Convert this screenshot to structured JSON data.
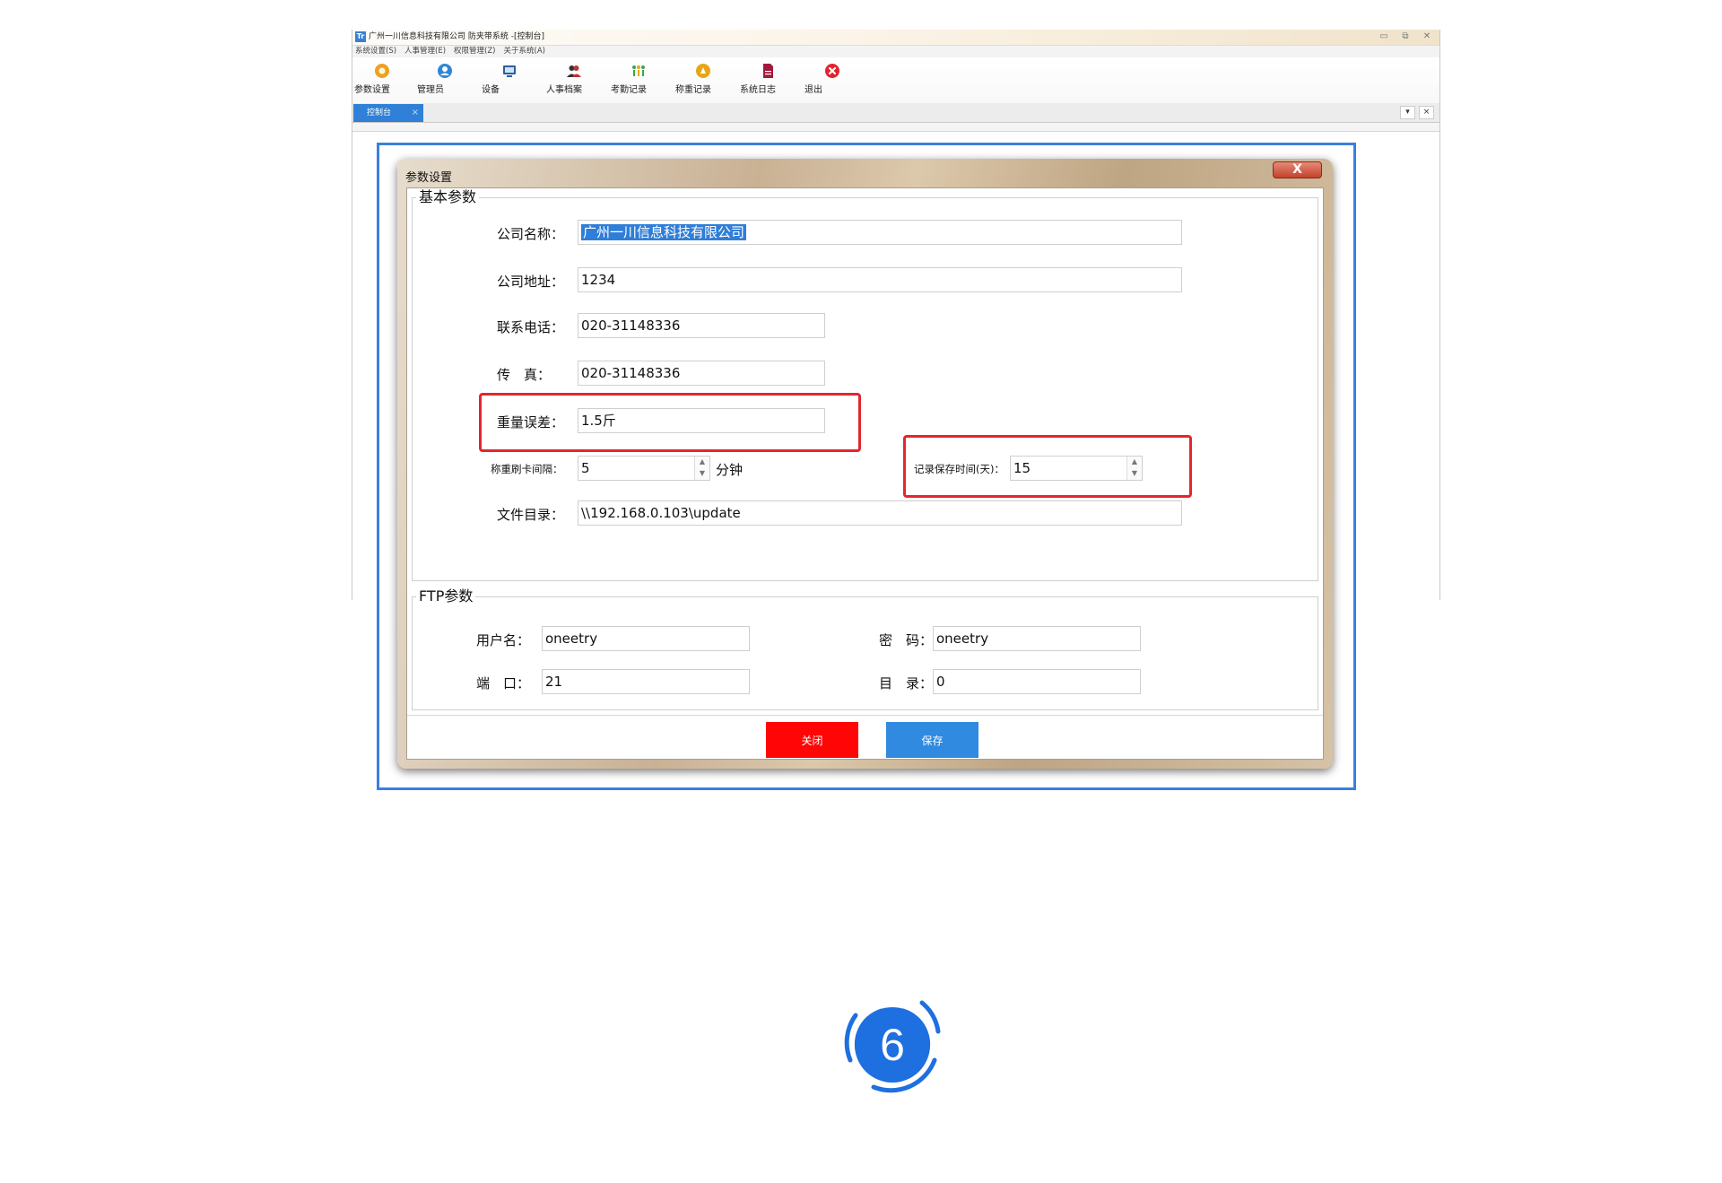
{
  "app": {
    "logo_text": "Tr",
    "title": "广州一川信息科技有限公司 防夹带系统 -[控制台]",
    "menu": [
      "系统设置(S)",
      "人事管理(E)",
      "权限管理(Z)",
      "关于系统(A)"
    ],
    "toolbar": [
      {
        "label": "参数设置",
        "icon": "settings-icon",
        "color": "#f0a020"
      },
      {
        "label": "管理员",
        "icon": "admin-icon",
        "color": "#2f86d6"
      },
      {
        "label": "设备",
        "icon": "monitor-icon",
        "color": "#2c5f9e"
      },
      {
        "label": "人事档案",
        "icon": "personnel-icon",
        "color": "#333333"
      },
      {
        "label": "考勤记录",
        "icon": "attendance-icon",
        "color": "#3aa845"
      },
      {
        "label": "称重记录",
        "icon": "weighing-icon",
        "color": "#e8a614"
      },
      {
        "label": "系统日志",
        "icon": "log-icon",
        "color": "#a01a3c"
      },
      {
        "label": "退出",
        "icon": "exit-icon",
        "color": "#e2232f"
      }
    ],
    "tab": {
      "label": "控制台",
      "close": "×"
    },
    "tab_buttons": [
      "▾",
      "×"
    ]
  },
  "dialog": {
    "title": "参数设置",
    "close_label": "X",
    "basic_group": {
      "legend": "基本参数",
      "company_name_label": "公司名称：",
      "company_name": "广州一川信息科技有限公司",
      "company_address_label": "公司地址：",
      "company_address": "1234",
      "phone_label": "联系电话：",
      "phone": "020-31148336",
      "fax_label": "传　真：",
      "fax": "020-31148336",
      "weight_error_label": "重量误差：",
      "weight_error": "1.5斤",
      "weigh_interval_label": "称重刷卡间隔：",
      "weigh_interval": "5",
      "weigh_interval_unit": "分钟",
      "record_keep_label": "记录保存时间(天)：",
      "record_keep_days": "15",
      "file_dir_label": "文件目录：",
      "file_dir": "\\\\192.168.0.103\\update"
    },
    "ftp_group": {
      "legend": "FTP参数",
      "username_label": "用户名：",
      "username": "oneetry",
      "password_label": "密　码：",
      "password": "oneetry",
      "port_label": "端　口：",
      "port": "21",
      "directory_label": "目　录：",
      "directory": "0"
    },
    "buttons": {
      "close": "关闭",
      "save": "保存"
    }
  },
  "step_badge": {
    "number": "6",
    "color": "#1e6fe0"
  }
}
